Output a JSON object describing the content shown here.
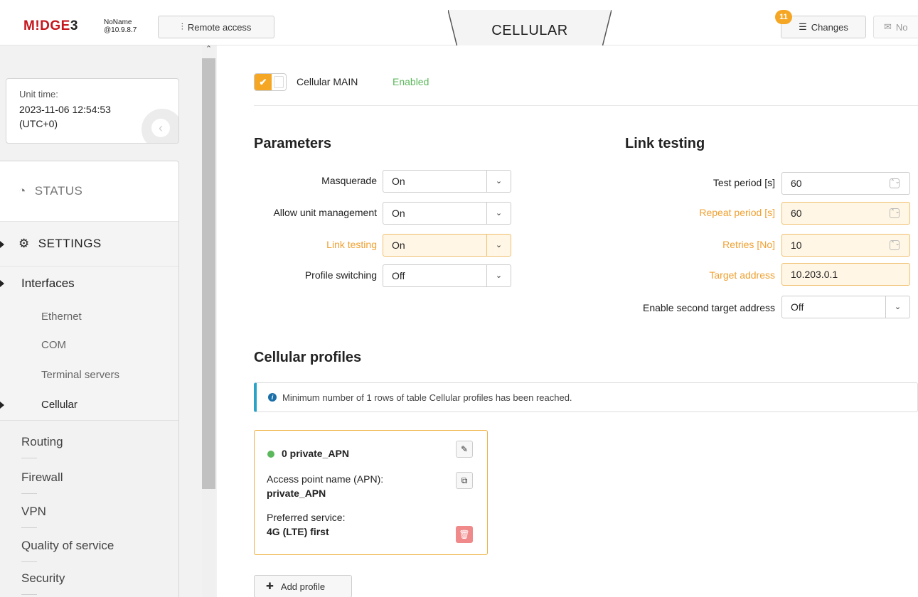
{
  "header": {
    "logo_main": "M!DGE",
    "logo_num": "3",
    "host_name": "NoName",
    "host_ip": "@10.9.8.7",
    "remote_access_label": "Remote access",
    "page_tab": "CELLULAR",
    "changes_count": "11",
    "changes_label": "Changes",
    "notifications_label": "No"
  },
  "sidebar": {
    "unit_time_label": "Unit time:",
    "unit_time_value": "2023-11-06 12:54:53",
    "unit_time_tz": "(UTC+0)",
    "status_label": "STATUS",
    "settings_label": "SETTINGS",
    "interfaces_label": "Interfaces",
    "interfaces_items": [
      "Ethernet",
      "COM",
      "Terminal servers",
      "Cellular"
    ],
    "active_item": "Cellular",
    "lower_items": [
      "Routing",
      "Firewall",
      "VPN",
      "Quality of service",
      "Security"
    ]
  },
  "cellular_main": {
    "label": "Cellular MAIN",
    "status": "Enabled",
    "enabled": true
  },
  "parameters": {
    "title": "Parameters",
    "fields": [
      {
        "label": "Masquerade",
        "value": "On",
        "modified": false
      },
      {
        "label": "Allow unit management",
        "value": "On",
        "modified": false
      },
      {
        "label": "Link testing",
        "value": "On",
        "modified": true
      },
      {
        "label": "Profile switching",
        "value": "Off",
        "modified": false
      }
    ]
  },
  "link_testing": {
    "title": "Link testing",
    "fields": [
      {
        "label": "Test period [s]",
        "value": "60",
        "modified": false
      },
      {
        "label": "Repeat period [s]",
        "value": "60",
        "modified": true
      },
      {
        "label": "Retries [No]",
        "value": "10",
        "modified": true
      },
      {
        "label": "Target address",
        "value": "10.203.0.1",
        "modified": true
      },
      {
        "label": "Enable second target address",
        "value": "Off",
        "modified": false
      }
    ]
  },
  "profiles": {
    "title": "Cellular profiles",
    "info_message": "Minimum number of 1 rows of table Cellular profiles has been reached.",
    "items": [
      {
        "name": "0 private_APN",
        "apn_label": "Access point name (APN):",
        "apn_value": "private_APN",
        "service_label": "Preferred service:",
        "service_value": "4G (LTE) first"
      }
    ],
    "add_label": "Add profile"
  },
  "colors": {
    "accent": "#f5a623",
    "enabled": "#5cb85c",
    "logo_red": "#c4161c",
    "info": "#2aa3c8"
  }
}
